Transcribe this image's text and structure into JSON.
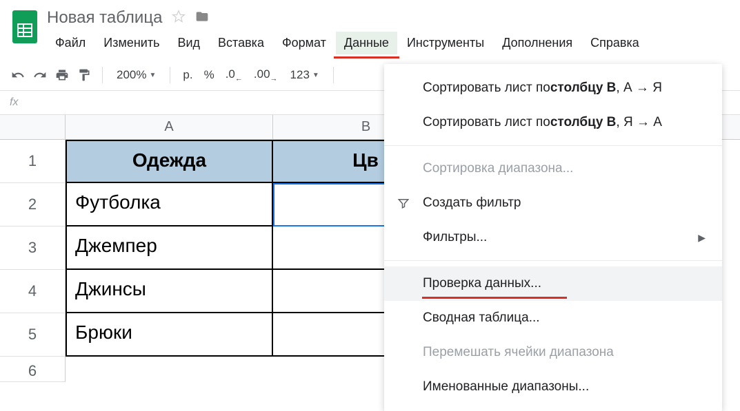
{
  "doc_title": "Новая таблица",
  "menus": {
    "file": "Файл",
    "edit": "Изменить",
    "view": "Вид",
    "insert": "Вставка",
    "format": "Формат",
    "data": "Данные",
    "tools": "Инструменты",
    "addons": "Дополнения",
    "help": "Справка"
  },
  "toolbar": {
    "zoom": "200%",
    "currency": "р.",
    "percent": "%",
    "dec_decrease": ".0",
    "dec_increase": ".00",
    "format_more": "123"
  },
  "formula_bar": {
    "fx": "fx"
  },
  "columns": {
    "a": "A",
    "b": "B"
  },
  "rows": [
    "1",
    "2",
    "3",
    "4",
    "5",
    "6"
  ],
  "table": {
    "header": {
      "a": "Одежда",
      "b": "Цв"
    },
    "data": [
      {
        "a": "Футболка",
        "b": ""
      },
      {
        "a": "Джемпер",
        "b": ""
      },
      {
        "a": "Джинсы",
        "b": ""
      },
      {
        "a": "Брюки",
        "b": ""
      }
    ]
  },
  "dropdown": {
    "sort_asc_prefix": "Сортировать лист по ",
    "sort_asc_bold": "столбцу B",
    "sort_asc_suffix": ", А → Я",
    "sort_desc_prefix": "Сортировать лист по ",
    "sort_desc_bold": "столбцу B",
    "sort_desc_suffix": ", Я → А",
    "sort_range": "Сортировка диапазона...",
    "create_filter": "Создать фильтр",
    "filters": "Фильтры...",
    "data_validation": "Проверка данных...",
    "pivot_table": "Сводная таблица...",
    "shuffle_range": "Перемешать ячейки диапазона",
    "named_ranges": "Именованные диапазоны..."
  }
}
